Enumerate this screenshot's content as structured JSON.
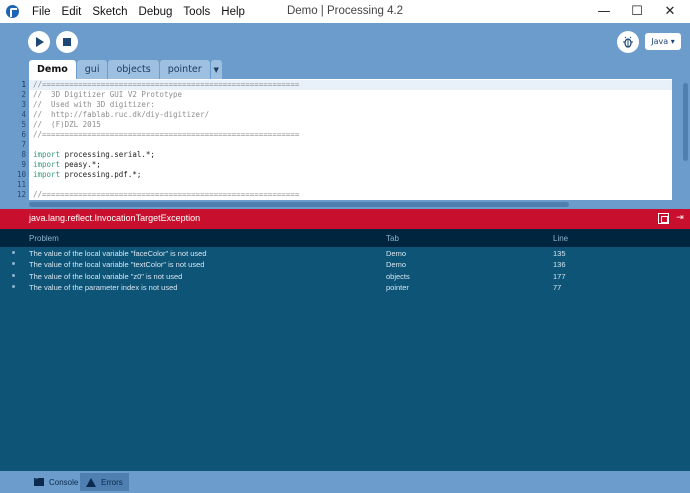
{
  "window": {
    "title": "Demo | Processing 4.2",
    "controls": {
      "minimize": "—",
      "maximize": "☐",
      "close": "✕"
    }
  },
  "menu": [
    "File",
    "Edit",
    "Sketch",
    "Debug",
    "Tools",
    "Help"
  ],
  "toolbar": {
    "run_icon": "play-icon",
    "stop_icon": "stop-icon",
    "debug_icon": "bug-icon",
    "mode_label": "Java ▾"
  },
  "tabs": [
    "Demo",
    "gui",
    "objects",
    "pointer"
  ],
  "tab_menu_glyph": "▼",
  "editor": {
    "line_numbers": [
      "1",
      "2",
      "3",
      "4",
      "5",
      "6",
      "7",
      "8",
      "9",
      "10",
      "11",
      "12"
    ],
    "lines": [
      [
        {
          "t": "//=========================================================",
          "c": "cmt"
        }
      ],
      [
        {
          "t": "//  3D Digitizer GUI V2 Prototype",
          "c": "cmt"
        }
      ],
      [
        {
          "t": "//  Used with 3D digitizer:",
          "c": "cmt"
        }
      ],
      [
        {
          "t": "//  http://fablab.ruc.dk/diy-digitizer/",
          "c": "cmt"
        }
      ],
      [
        {
          "t": "//  (F)DZL 2015",
          "c": "cmt"
        }
      ],
      [
        {
          "t": "//=========================================================",
          "c": "cmt"
        }
      ],
      [],
      [
        {
          "t": "import",
          "c": "kw"
        },
        {
          "t": " processing.serial.*;",
          "c": ""
        }
      ],
      [
        {
          "t": "import",
          "c": "kw"
        },
        {
          "t": " peasy.*;",
          "c": ""
        }
      ],
      [
        {
          "t": "import",
          "c": "kw"
        },
        {
          "t": " processing.pdf.*;",
          "c": ""
        }
      ],
      [],
      [
        {
          "t": "//=========================================================",
          "c": "cmt"
        }
      ]
    ]
  },
  "error_bar": {
    "message": "java.lang.reflect.InvocationTargetException"
  },
  "problems": {
    "headers": {
      "problem": "Problem",
      "tab": "Tab",
      "line": "Line"
    },
    "rows": [
      {
        "problem": "The value of the local variable \"faceColor\" is not used",
        "tab": "Demo",
        "line": "135"
      },
      {
        "problem": "The value of the local variable \"textColor\" is not used",
        "tab": "Demo",
        "line": "136"
      },
      {
        "problem": "The value of the local variable \"z0\" is not used",
        "tab": "objects",
        "line": "177"
      },
      {
        "problem": "The value of the parameter index is not used",
        "tab": "pointer",
        "line": "77"
      }
    ]
  },
  "footer": {
    "console_label": "Console",
    "errors_label": "Errors"
  }
}
